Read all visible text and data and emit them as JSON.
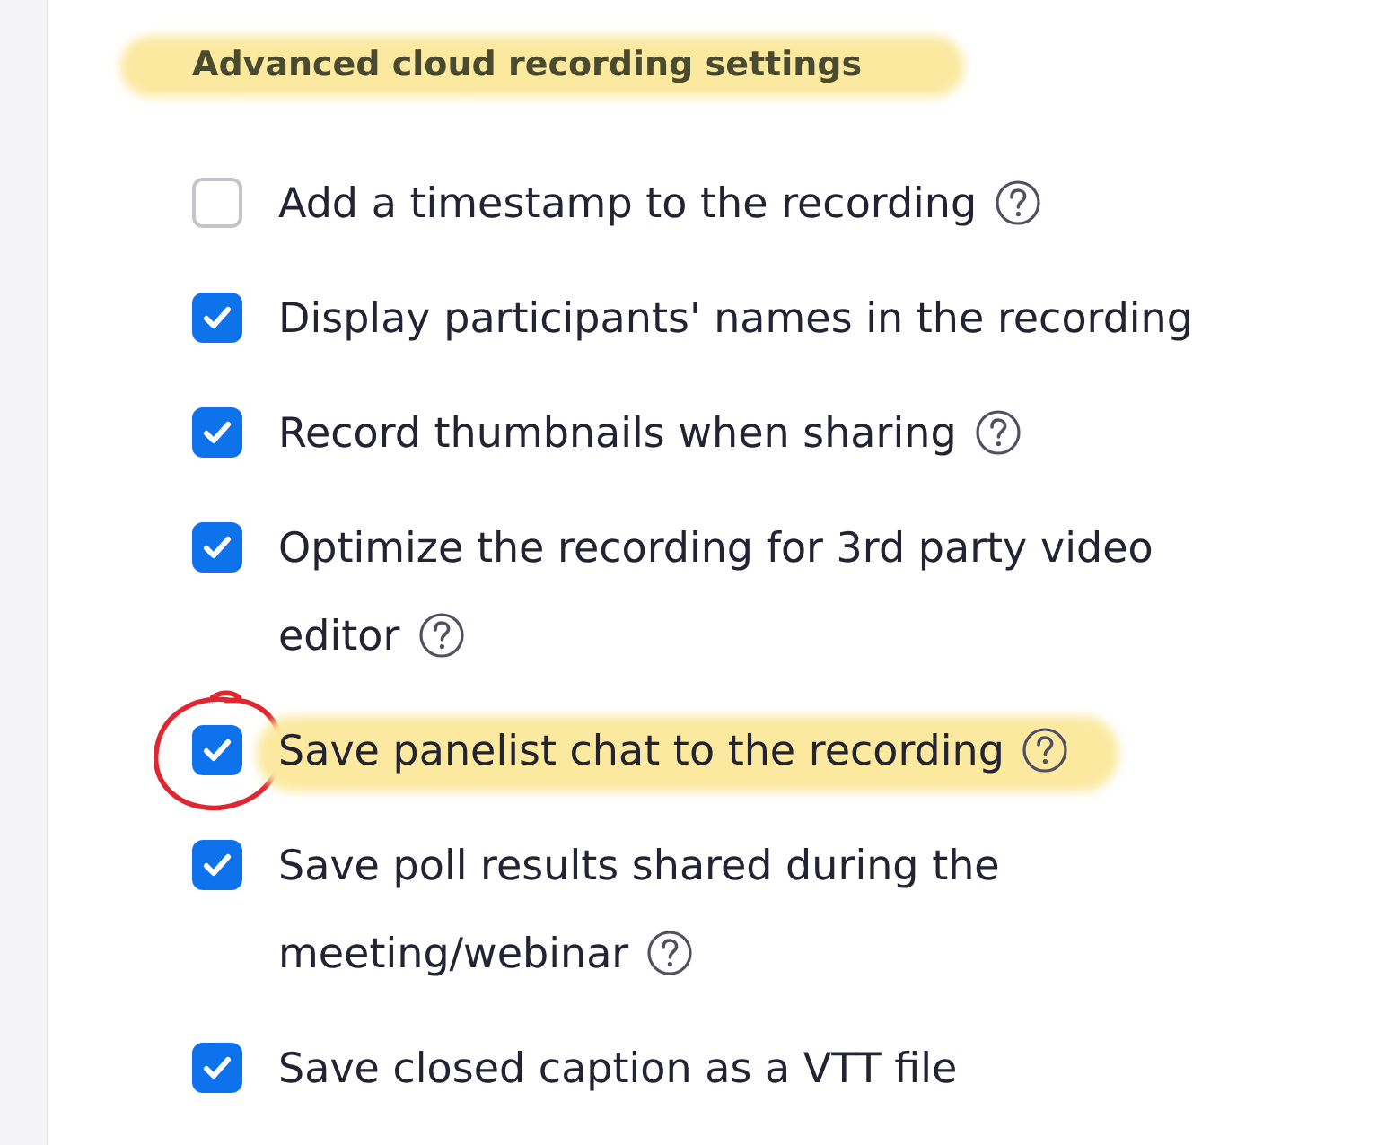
{
  "section": {
    "title": "Advanced cloud recording settings",
    "highlighted": true
  },
  "options": [
    {
      "label": "Add a timestamp to the recording",
      "checked": false,
      "help": true,
      "highlighted": false,
      "circled": false
    },
    {
      "label": "Display participants' names in the recording",
      "checked": true,
      "help": false,
      "highlighted": false,
      "circled": false
    },
    {
      "label": "Record thumbnails when sharing",
      "checked": true,
      "help": true,
      "highlighted": false,
      "circled": false
    },
    {
      "label": "Optimize the recording for 3rd party video editor",
      "checked": true,
      "help": true,
      "highlighted": false,
      "circled": false
    },
    {
      "label": "Save panelist chat to the recording",
      "checked": true,
      "help": true,
      "highlighted": true,
      "circled": true
    },
    {
      "label": "Save poll results shared during the meeting/webinar",
      "checked": true,
      "help": true,
      "highlighted": false,
      "circled": false
    },
    {
      "label": "Save closed caption as a VTT file",
      "checked": true,
      "help": false,
      "highlighted": false,
      "circled": false
    }
  ]
}
